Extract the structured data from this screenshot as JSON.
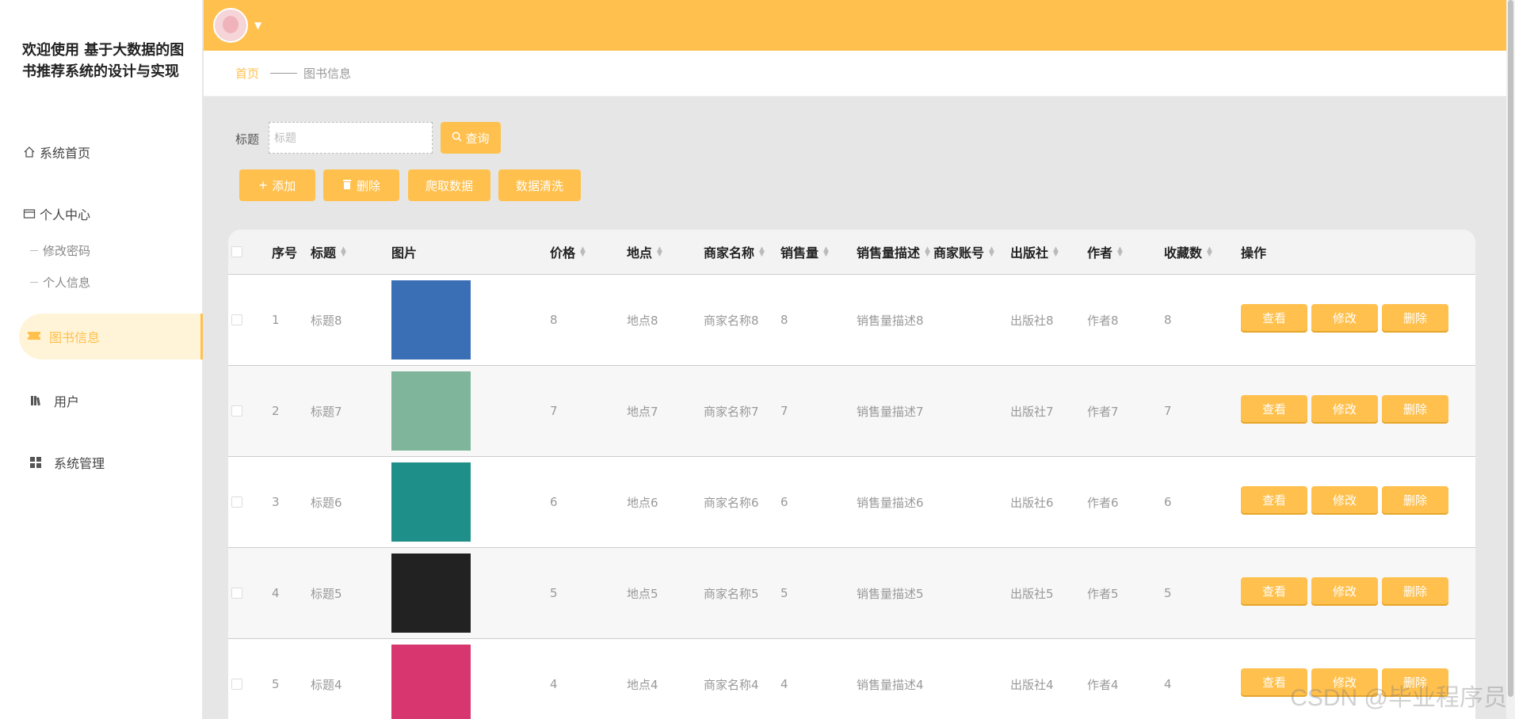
{
  "app": {
    "title": "欢迎使用 基于大数据的图书推荐系统的设计与实现"
  },
  "sidebar": {
    "home": "系统首页",
    "personal_center": "个人中心",
    "change_password": "修改密码",
    "personal_info": "个人信息",
    "book_info": "图书信息",
    "users": "用户",
    "system_manage": "系统管理"
  },
  "breadcrumb": {
    "home": "首页",
    "current": "图书信息"
  },
  "search": {
    "label": "标题",
    "placeholder": "标题",
    "button": "查询"
  },
  "actions": {
    "add": "添加",
    "delete": "删除",
    "crawl": "爬取数据",
    "clean": "数据清洗"
  },
  "table": {
    "headers": {
      "index": "序号",
      "title": "标题",
      "image": "图片",
      "price": "价格",
      "location": "地点",
      "merchant": "商家名称",
      "sales": "销售量",
      "sales_desc": "销售量描述",
      "merchant_account": "商家账号",
      "publisher": "出版社",
      "author": "作者",
      "favorites": "收藏数",
      "ops": "操作"
    },
    "op_labels": {
      "view": "查看",
      "edit": "修改",
      "delete": "删除"
    },
    "rows": [
      {
        "index": "1",
        "title": "标题8",
        "price": "8",
        "location": "地点8",
        "merchant": "商家名称8",
        "sales": "8",
        "sales_desc": "销售量描述8",
        "publisher": "出版社8",
        "author": "作者8",
        "favorites": "8",
        "cover_color": "#3a6fb5"
      },
      {
        "index": "2",
        "title": "标题7",
        "price": "7",
        "location": "地点7",
        "merchant": "商家名称7",
        "sales": "7",
        "sales_desc": "销售量描述7",
        "publisher": "出版社7",
        "author": "作者7",
        "favorites": "7",
        "cover_color": "#7fb59a"
      },
      {
        "index": "3",
        "title": "标题6",
        "price": "6",
        "location": "地点6",
        "merchant": "商家名称6",
        "sales": "6",
        "sales_desc": "销售量描述6",
        "publisher": "出版社6",
        "author": "作者6",
        "favorites": "6",
        "cover_color": "#1f8f8a"
      },
      {
        "index": "4",
        "title": "标题5",
        "price": "5",
        "location": "地点5",
        "merchant": "商家名称5",
        "sales": "5",
        "sales_desc": "销售量描述5",
        "publisher": "出版社5",
        "author": "作者5",
        "favorites": "5",
        "cover_color": "#222222"
      },
      {
        "index": "5",
        "title": "标题4",
        "price": "4",
        "location": "地点4",
        "merchant": "商家名称4",
        "sales": "4",
        "sales_desc": "销售量描述4",
        "publisher": "出版社4",
        "author": "作者4",
        "favorites": "4",
        "cover_color": "#d8366e"
      }
    ]
  },
  "watermark": "CSDN @毕业程序员",
  "colors": {
    "accent": "#ffc04d",
    "active_bg": "#fff4d8"
  }
}
